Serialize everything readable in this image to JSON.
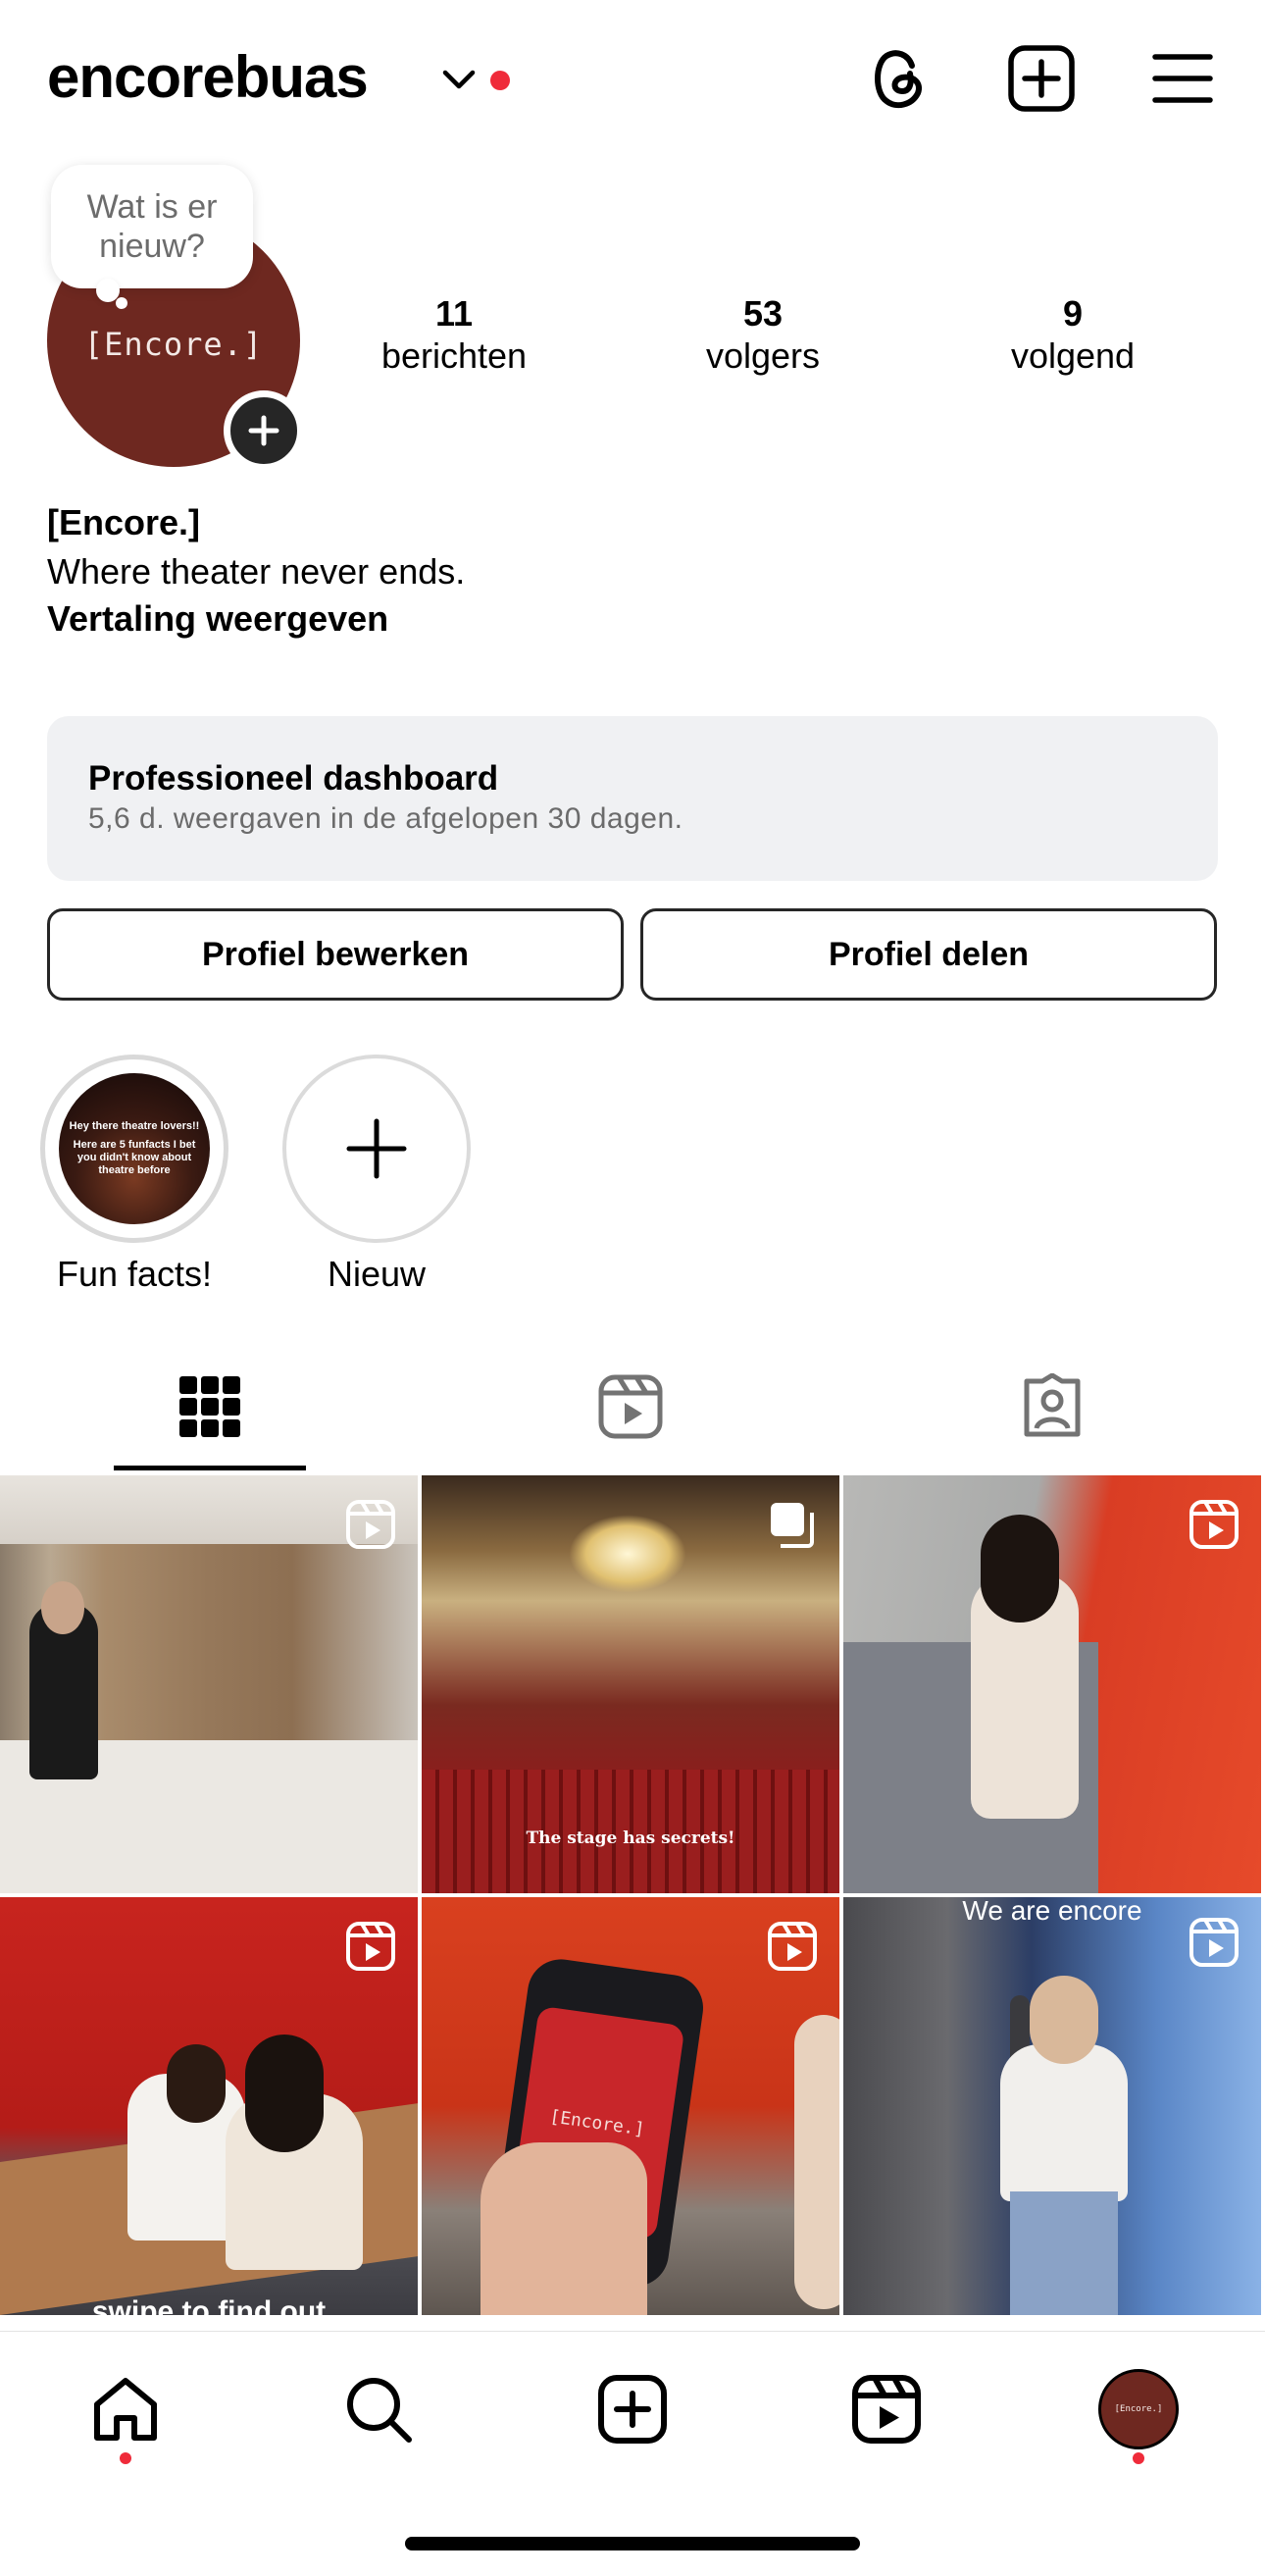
{
  "header": {
    "username": "encorebuas",
    "icons": [
      "threads-icon",
      "create-icon",
      "menu-icon"
    ]
  },
  "profile": {
    "avatar_text": "[Encore.]",
    "note": "Wat is er nieuw?",
    "stats": [
      {
        "number": "11",
        "label": "berichten"
      },
      {
        "number": "53",
        "label": "volgers"
      },
      {
        "number": "9",
        "label": "volgend"
      }
    ],
    "name": "[Encore.]",
    "bio": "Where theater never ends.",
    "translate": "Vertaling weergeven"
  },
  "dashboard": {
    "title": "Professioneel dashboard",
    "subtitle": "5,6 d. weergaven in de afgelopen 30 dagen."
  },
  "buttons": {
    "edit": "Profiel bewerken",
    "share": "Profiel delen"
  },
  "highlights": [
    {
      "label": "Fun facts!",
      "cover_line1": "Hey there theatre lovers!!",
      "cover_line2": "Here are 5 funfacts I bet you didn't know about theatre before"
    },
    {
      "label": "Nieuw"
    }
  ],
  "grid": {
    "captions": [
      "The stage has secrets!",
      "We are encore",
      "swipe to find out"
    ],
    "phone_text": "[Encore.]"
  },
  "colors": {
    "brand_maroon": "#6e2820",
    "notification_red": "#ef2b3a",
    "dashboard_bg": "#f0f1f3"
  }
}
